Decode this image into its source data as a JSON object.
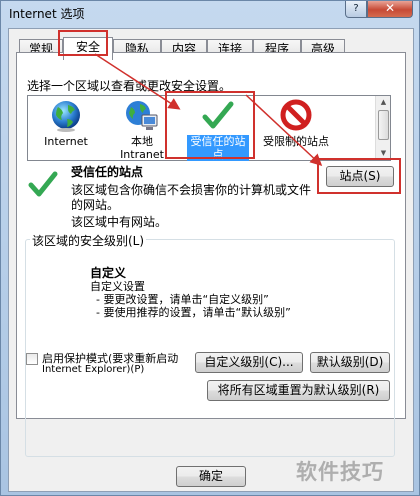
{
  "window": {
    "title": "Internet 选项",
    "help_label": "?",
    "close_label": "✕"
  },
  "tabs": [
    {
      "label": "常规"
    },
    {
      "label": "安全"
    },
    {
      "label": "隐私"
    },
    {
      "label": "内容"
    },
    {
      "label": "连接"
    },
    {
      "label": "程序"
    },
    {
      "label": "高级"
    }
  ],
  "active_tab": "安全",
  "security": {
    "prompt": "选择一个区域以查看或更改安全设置。",
    "zones": [
      {
        "label": "Internet",
        "icon": "globe-icon"
      },
      {
        "label": "本地 Intranet",
        "icon": "local-intranet-icon"
      },
      {
        "label": "受信任的站点",
        "icon": "trusted-checkmark-icon"
      },
      {
        "label": "受限制的站点",
        "icon": "restricted-no-icon"
      }
    ],
    "selected_zone": "受信任的站点",
    "zone_title": "受信任的站点",
    "zone_desc": "该区域包含你确信不会损害你的计算机或文件的网站。",
    "zone_status": "该区域中有网站。",
    "sites_button": "站点(S)",
    "level_group_label": "该区域的安全级别(L)",
    "level_title": "自定义",
    "level_lines": [
      "自定义设置",
      "- 要更改设置，请单击“自定义级别”",
      "- 要使用推荐的设置，请单击“默认级别”"
    ],
    "protected_mode_label": "启用保护模式(要求重新启动",
    "protected_mode_label2": "Internet Explorer)(P)",
    "protected_mode_checked": false,
    "custom_level_button": "自定义级别(C)...",
    "default_level_button": "默认级别(D)",
    "reset_all_button": "将所有区域重置为默认级别(R)"
  },
  "footer": {
    "ok_button": "确定"
  },
  "watermark": "软件技巧",
  "colors": {
    "annotation_red": "#d0312d",
    "selection_blue": "#3399ff",
    "close_red": "#c74a36"
  }
}
